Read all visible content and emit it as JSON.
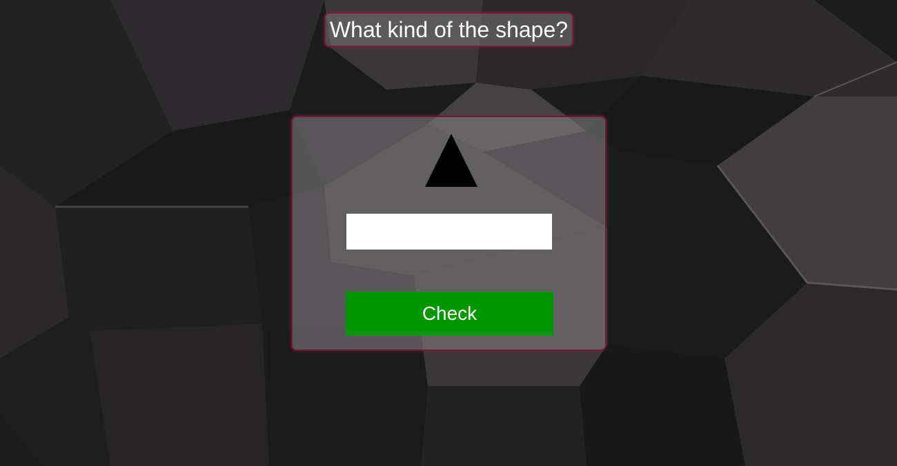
{
  "question": {
    "text": "What kind of the shape?"
  },
  "quiz": {
    "shape_icon": "triangle-icon",
    "answer_value": "",
    "answer_placeholder": "",
    "check_label": "Check"
  },
  "colors": {
    "card_border": "#6e1a36",
    "check_button": "#009600",
    "shape_fill": "#000000"
  }
}
